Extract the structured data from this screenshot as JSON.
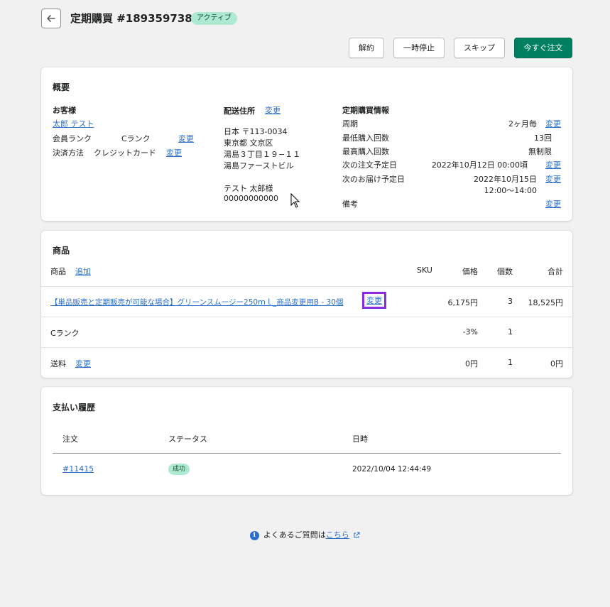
{
  "header": {
    "title": "定期購買 #1893597389",
    "status_badge": "アクティブ"
  },
  "actions": {
    "cancel": "解約",
    "pause": "一時停止",
    "skip": "スキップ",
    "order_now": "今すぐ注文"
  },
  "summary": {
    "title": "概要",
    "customer": {
      "heading": "お客様",
      "name": "太郎 テスト",
      "rank_label": "会員ランク",
      "rank_value": "Cランク",
      "rank_change": "変更",
      "payment_label": "決済方法",
      "payment_value": "クレジットカード",
      "payment_change": "変更"
    },
    "shipping": {
      "heading": "配送住所",
      "change": "変更",
      "line1": "日本 〒113-0034",
      "line2": "東京都 文京区",
      "line3": "湯島３丁目１９−１１",
      "line4": "湯島ファーストビル",
      "name": "テスト 太郎様",
      "phone": "00000000000"
    },
    "subscription": {
      "heading": "定期購買情報",
      "cycle_label": "周期",
      "cycle_value": "2ヶ月毎",
      "cycle_change": "変更",
      "min_label": "最低購入回数",
      "min_value": "13回",
      "max_label": "最高購入回数",
      "max_value": "無制限",
      "next_order_label": "次の注文予定日",
      "next_order_value": "2022年10月12日 00:00頃",
      "next_order_change": "変更",
      "next_delivery_label": "次のお届け予定日",
      "next_delivery_date": "2022年10月15日",
      "next_delivery_time": "12:00～14:00",
      "next_delivery_change": "変更",
      "note_label": "備考",
      "note_change": "変更"
    }
  },
  "products": {
    "title": "商品",
    "col_product": "商品",
    "add": "追加",
    "col_sku": "SKU",
    "col_price": "価格",
    "col_qty": "個数",
    "col_total": "合計",
    "rows": [
      {
        "name": "【単品販売と定期販売が可能な場合】グリーンスムージー250ｍｌ_商品変更用B - 30個",
        "change": "変更",
        "price": "6,175円",
        "qty": "3",
        "total": "18,525円"
      },
      {
        "name": "Cランク",
        "price": "-3%",
        "qty": "1",
        "total": ""
      },
      {
        "name": "送料",
        "change": "変更",
        "price": "0円",
        "qty": "1",
        "total": "0円"
      }
    ]
  },
  "payments": {
    "title": "支払い履歴",
    "col_order": "注文",
    "col_status": "ステータス",
    "col_datetime": "日時",
    "rows": [
      {
        "order": "#11415",
        "status": "成功",
        "datetime": "2022/10/04 12:44:49"
      }
    ]
  },
  "footer": {
    "faq_text": "よくあるご質問は",
    "faq_link": "こちら"
  }
}
